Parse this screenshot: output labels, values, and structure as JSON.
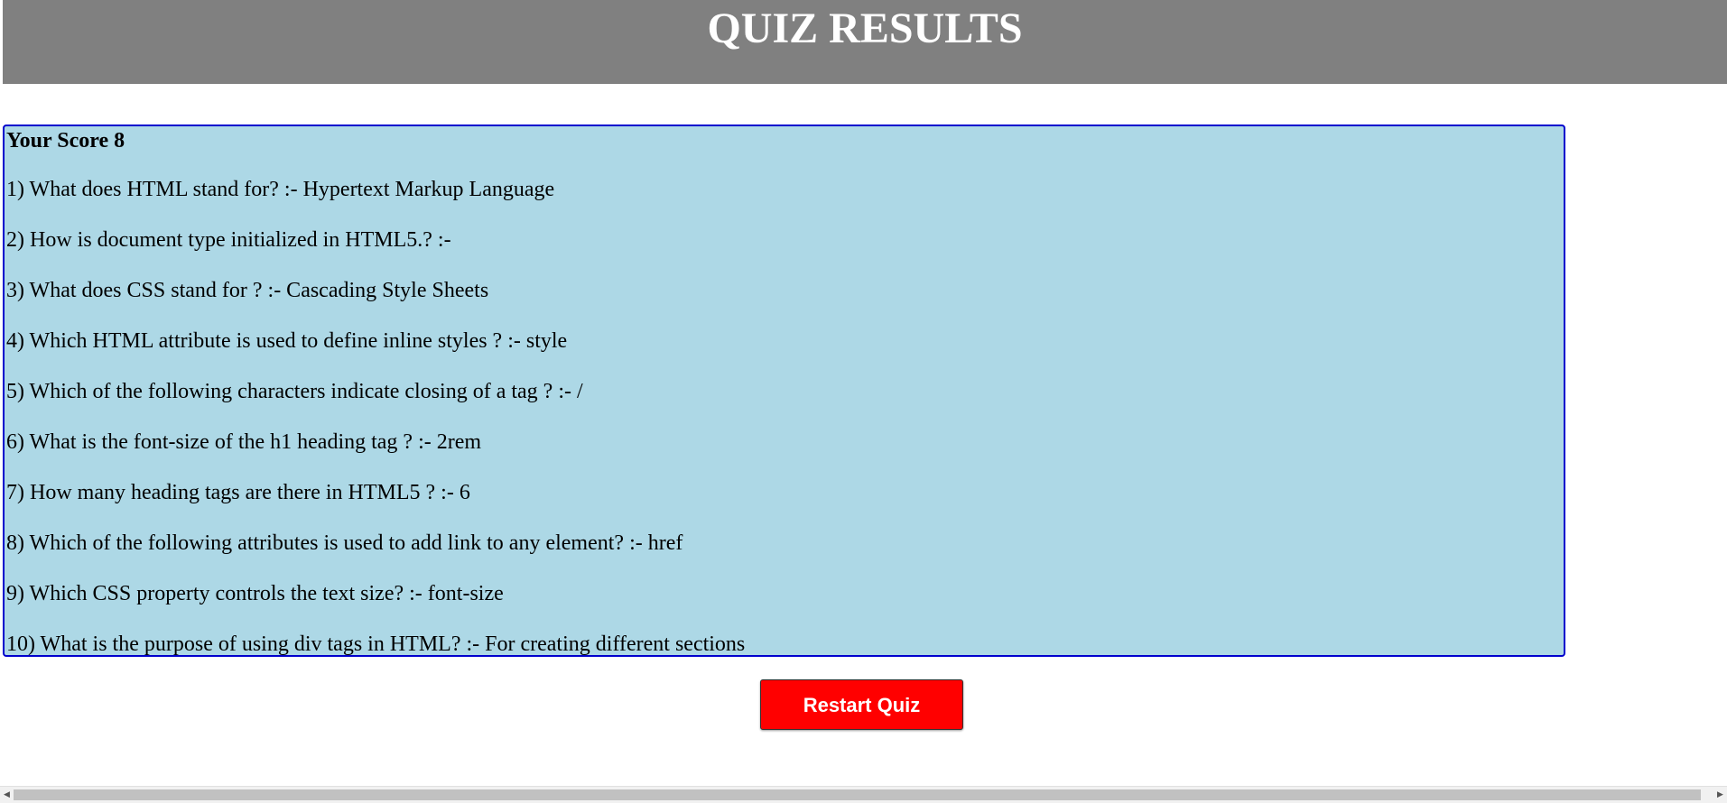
{
  "header": {
    "title": "QUIZ RESULTS"
  },
  "results": {
    "score_text": "Your Score 8",
    "answers": [
      "1) What does HTML stand for? :- Hypertext Markup Language",
      "2) How is document type initialized in HTML5.? :-",
      "3) What does CSS stand for ? :- Cascading Style Sheets",
      "4) Which HTML attribute is used to define inline styles ? :- style",
      "5) Which of the following characters indicate closing of a tag ? :- /",
      "6) What is the font-size of the h1 heading tag ? :- 2rem",
      "7) How many heading tags are there in HTML5 ? :- 6",
      "8) Which of the following attributes is used to add link to any element? :- href",
      "9) Which CSS property controls the text size? :- font-size",
      "10) What is the purpose of using div tags in HTML? :- For creating different sections"
    ]
  },
  "actions": {
    "restart_label": "Restart Quiz"
  },
  "scrollbar": {
    "left_arrow_icon": "triangle-left-icon",
    "right_arrow_icon": "triangle-right-icon"
  },
  "colors": {
    "header_bg": "#808080",
    "results_bg": "#add8e6",
    "results_border": "#0000cd",
    "button_bg": "#ff0000"
  }
}
